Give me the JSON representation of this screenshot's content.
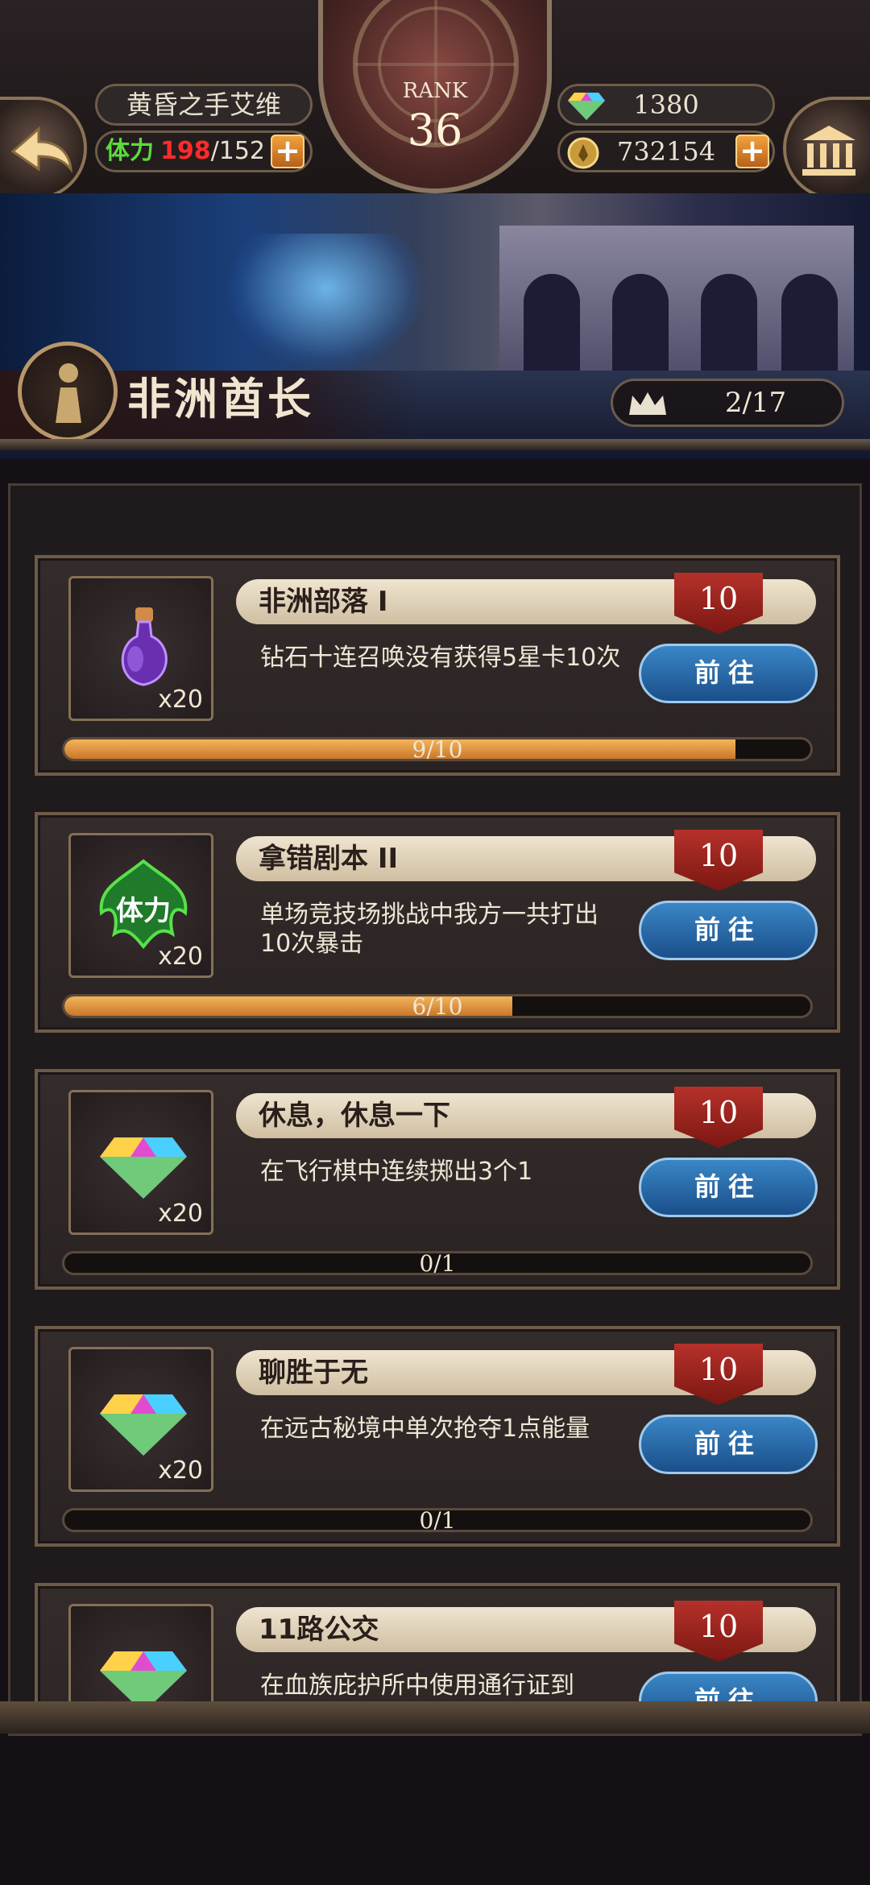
{
  "header": {
    "player_name": "黄昏之手艾维",
    "stamina_label": "体力",
    "stamina_current": "198",
    "stamina_max": "/152",
    "rank_label": "RANK",
    "rank_value": "36",
    "gems": "1380",
    "gold": "732154",
    "plus_symbol": "+"
  },
  "banner": {
    "title": "非洲酋长",
    "progress": "2/17"
  },
  "tasks": [
    {
      "title": "非洲部落 I",
      "points": "10",
      "desc": "钻石十连召唤没有获得5星卡10次",
      "qty": "x20",
      "reward_icon": "potion-icon",
      "button": "前往",
      "progress": "9/10",
      "fill": 0.9
    },
    {
      "title": "拿错剧本 II",
      "points": "10",
      "desc": "单场竞技场挑战中我方一共打出10次暴击",
      "qty": "x20",
      "reward_icon": "stamina-icon",
      "reward_text": "体力",
      "button": "前往",
      "progress": "6/10",
      "fill": 0.6
    },
    {
      "title": "休息，休息一下",
      "points": "10",
      "desc": "在飞行棋中连续掷出3个1",
      "qty": "x20",
      "reward_icon": "diamond-icon",
      "button": "前往",
      "progress": "0/1",
      "fill": 0
    },
    {
      "title": "聊胜于无",
      "points": "10",
      "desc": "在远古秘境中单次抢夺1点能量",
      "qty": "x20",
      "reward_icon": "diamond-icon",
      "button": "前往",
      "progress": "0/1",
      "fill": 0
    },
    {
      "title": "11路公交",
      "points": "10",
      "desc": "在血族庇护所中使用通行证到",
      "reward_icon": "diamond-icon",
      "button": "前往"
    }
  ],
  "colors": {
    "stamina_label": "#5ddb3d",
    "stamina_current": "#ff2a2a",
    "progress_fill": "#e29a3f",
    "go_button": "#2a6aa8",
    "points_badge": "#9a2620"
  }
}
